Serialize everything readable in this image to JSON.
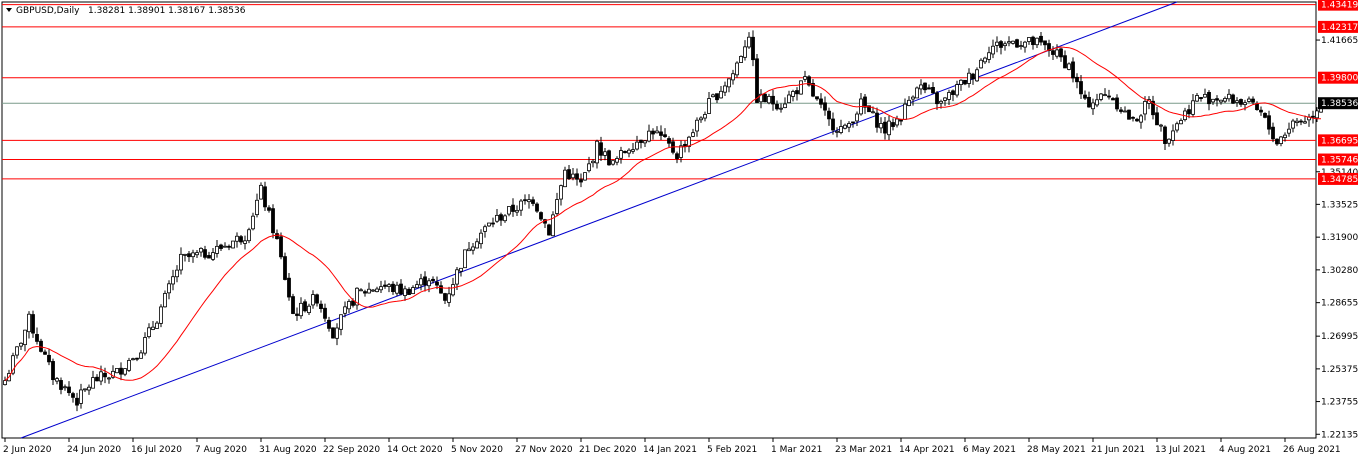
{
  "header": {
    "symbol_label": "GBPUSD,Daily",
    "ohlc": "1.38281 1.38901 1.38167 1.38536"
  },
  "chart_data": {
    "type": "candlestick",
    "price_range": [
      1.2195,
      1.4355
    ],
    "y_ticks": [
      1.41665,
      1.398,
      1.38536,
      1.36695,
      1.35746,
      1.3514,
      1.34785,
      1.33525,
      1.319,
      1.3028,
      1.28655,
      1.26995,
      1.25375,
      1.23755,
      1.22135
    ],
    "y_tick_labels": [
      "1.41665",
      "1.39800",
      "1.38536",
      "1.36695",
      "1.35746",
      "1.35140",
      "1.34785",
      "1.33525",
      "1.31900",
      "1.30280",
      "1.28655",
      "1.26995",
      "1.25375",
      "1.23755",
      "1.22135"
    ],
    "x_ticks": [
      {
        "label": "2 Jun 2020",
        "bar": 0
      },
      {
        "label": "24 Jun 2020",
        "bar": 16
      },
      {
        "label": "16 Jul 2020",
        "bar": 32
      },
      {
        "label": "7 Aug 2020",
        "bar": 48
      },
      {
        "label": "31 Aug 2020",
        "bar": 64
      },
      {
        "label": "22 Sep 2020",
        "bar": 80
      },
      {
        "label": "14 Oct 2020",
        "bar": 96
      },
      {
        "label": "5 Nov 2020",
        "bar": 112
      },
      {
        "label": "27 Nov 2020",
        "bar": 128
      },
      {
        "label": "21 Dec 2020",
        "bar": 144
      },
      {
        "label": "14 Jan 2021",
        "bar": 160
      },
      {
        "label": "5 Feb 2021",
        "bar": 176
      },
      {
        "label": "1 Mar 2021",
        "bar": 192
      },
      {
        "label": "23 Mar 2021",
        "bar": 208
      },
      {
        "label": "14 Apr 2021",
        "bar": 224
      },
      {
        "label": "6 May 2021",
        "bar": 240
      },
      {
        "label": "28 May 2021",
        "bar": 256
      },
      {
        "label": "21 Jun 2021",
        "bar": 272
      },
      {
        "label": "13 Jul 2021",
        "bar": 288
      },
      {
        "label": "4 Aug 2021",
        "bar": 304
      },
      {
        "label": "26 Aug 2021",
        "bar": 320
      }
    ],
    "bar_count": 330,
    "close_anchors": [
      [
        0,
        1.248
      ],
      [
        6,
        1.278
      ],
      [
        12,
        1.25
      ],
      [
        18,
        1.238
      ],
      [
        22,
        1.248
      ],
      [
        28,
        1.252
      ],
      [
        34,
        1.264
      ],
      [
        38,
        1.279
      ],
      [
        44,
        1.308
      ],
      [
        52,
        1.312
      ],
      [
        60,
        1.32
      ],
      [
        64,
        1.342
      ],
      [
        68,
        1.317
      ],
      [
        72,
        1.281
      ],
      [
        78,
        1.289
      ],
      [
        82,
        1.272
      ],
      [
        88,
        1.291
      ],
      [
        94,
        1.295
      ],
      [
        100,
        1.292
      ],
      [
        106,
        1.299
      ],
      [
        110,
        1.288
      ],
      [
        116,
        1.315
      ],
      [
        122,
        1.327
      ],
      [
        128,
        1.334
      ],
      [
        132,
        1.338
      ],
      [
        136,
        1.322
      ],
      [
        140,
        1.352
      ],
      [
        144,
        1.345
      ],
      [
        148,
        1.364
      ],
      [
        152,
        1.355
      ],
      [
        156,
        1.364
      ],
      [
        162,
        1.372
      ],
      [
        168,
        1.36
      ],
      [
        172,
        1.372
      ],
      [
        176,
        1.385
      ],
      [
        182,
        1.4
      ],
      [
        186,
        1.42
      ],
      [
        188,
        1.388
      ],
      [
        194,
        1.385
      ],
      [
        200,
        1.396
      ],
      [
        206,
        1.376
      ],
      [
        210,
        1.372
      ],
      [
        214,
        1.385
      ],
      [
        220,
        1.372
      ],
      [
        224,
        1.379
      ],
      [
        228,
        1.395
      ],
      [
        234,
        1.385
      ],
      [
        238,
        1.393
      ],
      [
        242,
        1.4
      ],
      [
        246,
        1.413
      ],
      [
        252,
        1.416
      ],
      [
        258,
        1.415
      ],
      [
        262,
        1.411
      ],
      [
        266,
        1.404
      ],
      [
        270,
        1.385
      ],
      [
        276,
        1.39
      ],
      [
        282,
        1.376
      ],
      [
        286,
        1.386
      ],
      [
        290,
        1.368
      ],
      [
        294,
        1.378
      ],
      [
        298,
        1.388
      ],
      [
        304,
        1.388
      ],
      [
        310,
        1.386
      ],
      [
        314,
        1.38
      ],
      [
        318,
        1.366
      ],
      [
        322,
        1.376
      ],
      [
        326,
        1.378
      ],
      [
        329,
        1.38536
      ]
    ],
    "moving_average": {
      "color": "#ff0000",
      "period": 21
    },
    "trendline": {
      "color": "#0000cd",
      "from": {
        "bar": 4,
        "price": 1.2195
      },
      "to": {
        "bar": 293,
        "price": 1.4355
      }
    },
    "current_price": 1.38536,
    "horizontal_levels": [
      {
        "price": 1.43419,
        "label": "1.43419"
      },
      {
        "price": 1.42317,
        "label": "1.42317"
      },
      {
        "price": 1.398,
        "label": "1.39800"
      },
      {
        "price": 1.36695,
        "label": "1.36695"
      },
      {
        "price": 1.35746,
        "label": "1.35746"
      },
      {
        "price": 1.34785,
        "label": "1.34785"
      }
    ],
    "colors": {
      "candle": "#000000",
      "level_line": "#ff0000",
      "level_tag": "#ff0000",
      "current_line": "#7a9a8a",
      "current_tag": "#000000",
      "border": "#000000"
    }
  }
}
